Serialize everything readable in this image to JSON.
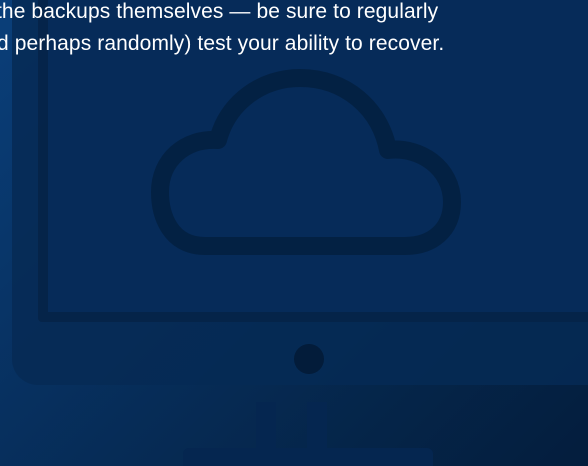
{
  "hero": {
    "text_lines": [
      "the backups themselves — be sure to regularly",
      "d perhaps randomly) test your ability to recover."
    ],
    "colors": {
      "background_start": "#0a3f7a",
      "background_end": "#041d3d",
      "monitor_fill": "#062a52",
      "monitor_outline": "#031a36",
      "text": "#ffffff"
    },
    "illustration_icons": [
      "monitor-icon",
      "cloud-icon"
    ]
  }
}
